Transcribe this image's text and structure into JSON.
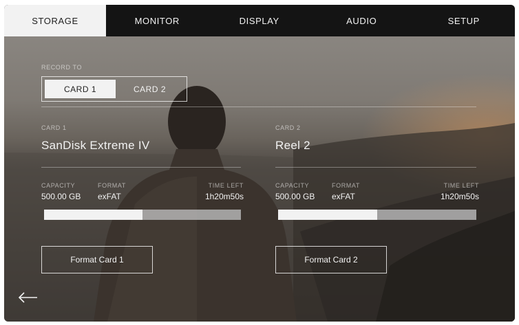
{
  "tabs": [
    {
      "label": "STORAGE",
      "active": true
    },
    {
      "label": "MONITOR"
    },
    {
      "label": "DISPLAY"
    },
    {
      "label": "AUDIO"
    },
    {
      "label": "SETUP"
    }
  ],
  "record_to": {
    "label": "RECORD TO",
    "options": [
      "CARD 1",
      "CARD 2"
    ],
    "selected": "CARD 1"
  },
  "cards": [
    {
      "slot_label": "CARD 1",
      "name": "SanDisk Extreme IV",
      "capacity_label": "CAPACITY",
      "capacity": "500.00 GB",
      "format_label": "FORMAT",
      "format": "exFAT",
      "time_left_label": "TIME LEFT",
      "time_left": "1h20m50s",
      "used_fraction": 0.5,
      "format_button": "Format Card 1"
    },
    {
      "slot_label": "CARD 2",
      "name": "Reel 2",
      "capacity_label": "CAPACITY",
      "capacity": "500.00 GB",
      "format_label": "FORMAT",
      "format": "exFAT",
      "time_left_label": "TIME LEFT",
      "time_left": "1h20m50s",
      "used_fraction": 0.5,
      "format_button": "Format Card 2"
    }
  ],
  "back_icon": "back-arrow-icon",
  "colors": {
    "tab_bar": "#141414",
    "active_tab": "#f2f2f2",
    "text": "#f2f2f2"
  }
}
